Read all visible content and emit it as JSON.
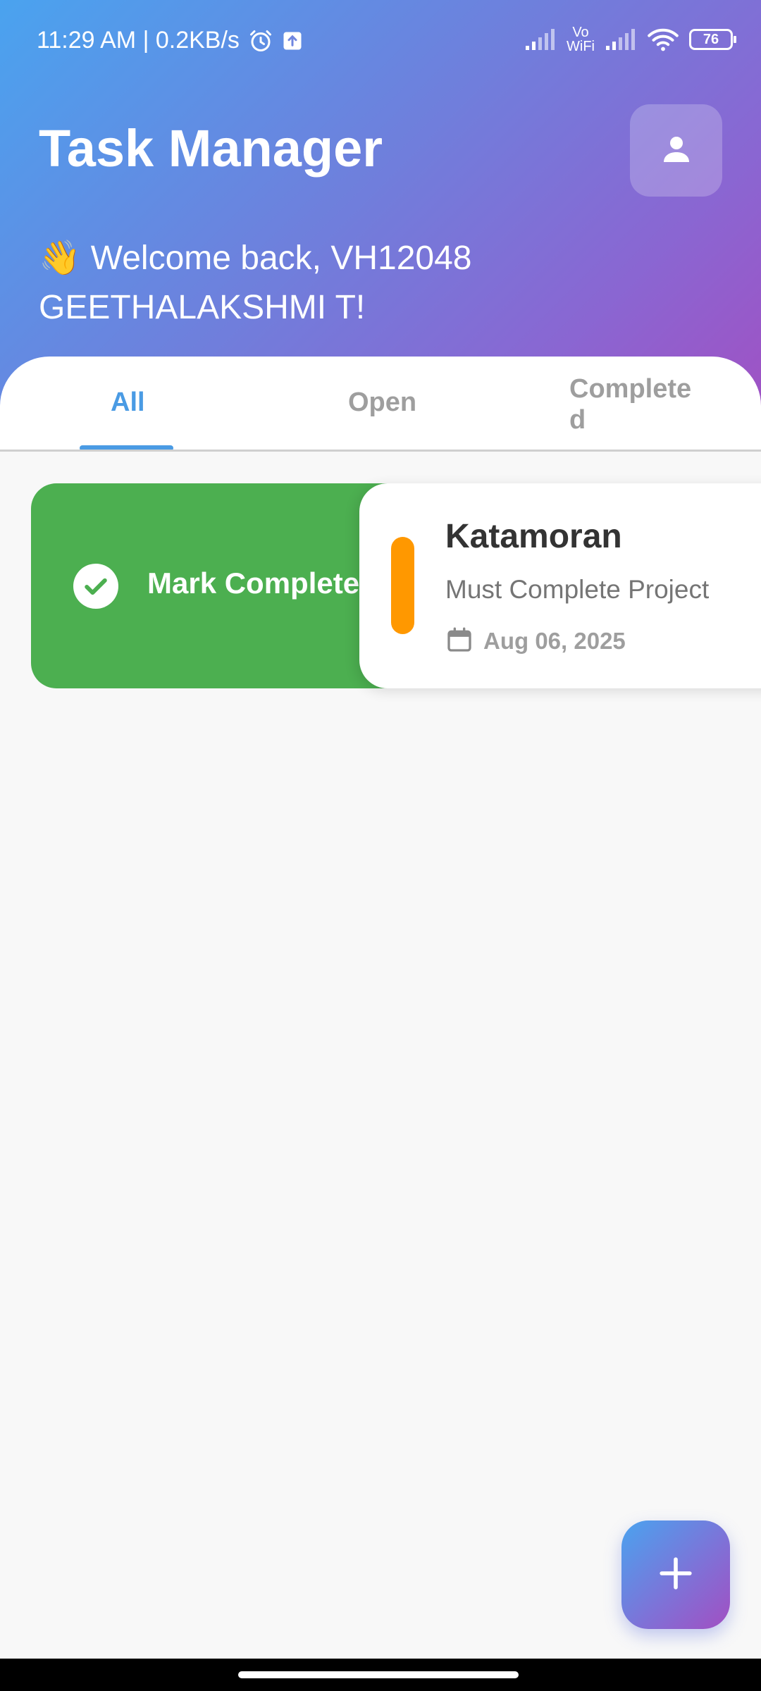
{
  "status_bar": {
    "time_speed": "11:29 AM | 0.2KB/s",
    "vowifi_label": "Vo WiFi",
    "battery_level": "76",
    "icons": [
      "alarm-icon",
      "upload-notification-icon",
      "signal-icon",
      "vowifi-icon",
      "wifi-icon",
      "battery-icon"
    ]
  },
  "header": {
    "title": "Task Manager",
    "welcome_emoji": "👋",
    "welcome_text": "Welcome back, VH12048 GEETHALAKSHMI T!",
    "profile_icon": "person-icon"
  },
  "tabs": [
    {
      "label": "All",
      "selected": true
    },
    {
      "label": "Open",
      "selected": false
    },
    {
      "label": "Completed",
      "selected": false
    }
  ],
  "swipe_action": {
    "label": "Mark Complete",
    "icon": "check-circle-icon",
    "color": "#4caf50"
  },
  "tasks": [
    {
      "title": "Katamoran",
      "description": "Must Complete Project",
      "date": "Aug 06, 2025",
      "priority_color": "#ff9800"
    }
  ],
  "fab": {
    "icon": "plus-icon"
  },
  "colors": {
    "accent": "#4a9be4",
    "gradient_start": "#4aa3ef",
    "gradient_end": "#a24fc2"
  }
}
